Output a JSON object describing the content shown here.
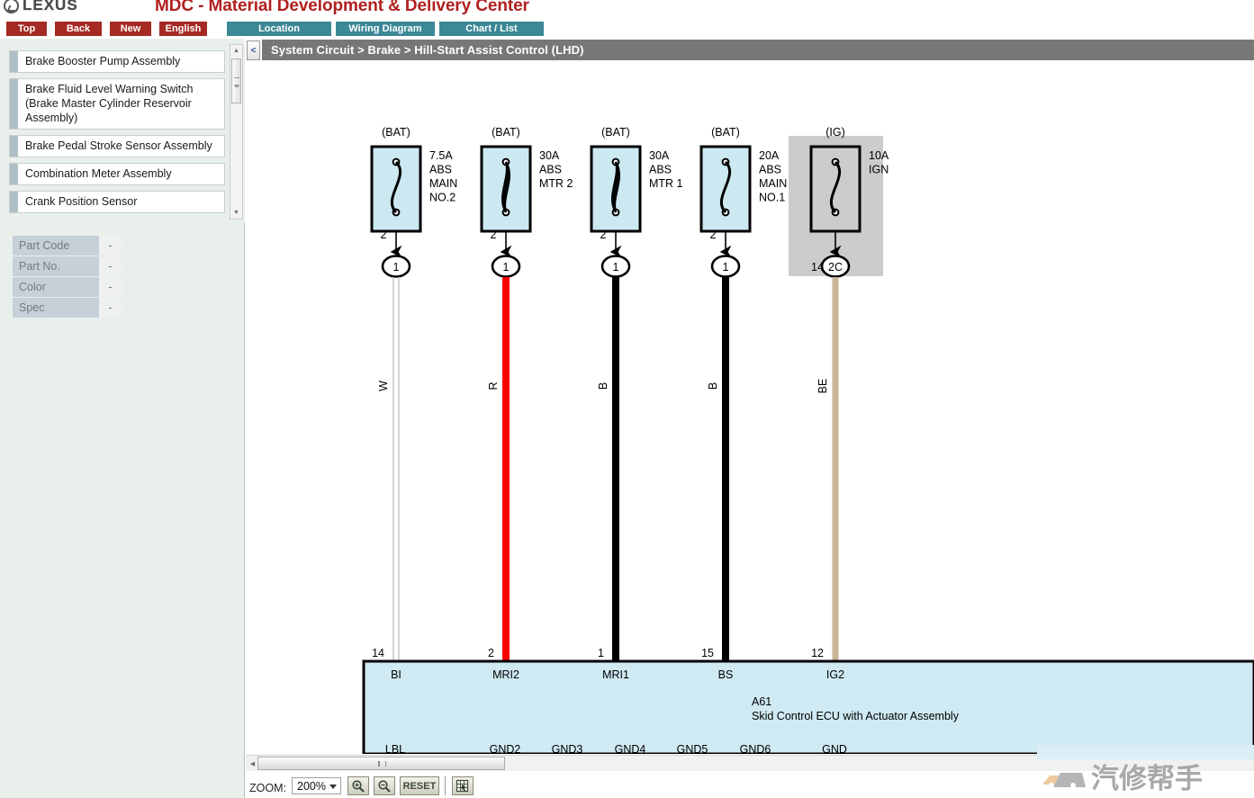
{
  "header": {
    "brand": "LEXUS",
    "brand_icon": "lexus-logo-icon",
    "title": "MDC - Material Development & Delivery Center"
  },
  "toolbar": {
    "nav_buttons": [
      {
        "label": "Top",
        "name": "top"
      },
      {
        "label": "Back",
        "name": "back"
      },
      {
        "label": "New",
        "name": "new"
      },
      {
        "label": "English",
        "name": "english"
      }
    ],
    "tabs": [
      {
        "label": "Location",
        "name": "location"
      },
      {
        "label": "Wiring Diagram",
        "name": "wiring-diagram"
      },
      {
        "label": "Chart / List",
        "name": "chart-list"
      }
    ],
    "red_color": "#a42a23",
    "teal_color": "#3c8896"
  },
  "sidebar": {
    "parts": [
      {
        "label": "Brake Booster Pump Assembly"
      },
      {
        "label": "Brake Fluid Level Warning Switch (Brake Master Cylinder Reservoir Assembly)"
      },
      {
        "label": "Brake Pedal Stroke Sensor Assembly"
      },
      {
        "label": "Combination Meter Assembly"
      },
      {
        "label": "Crank Position Sensor"
      }
    ],
    "part_info": [
      {
        "key": "Part Code",
        "value": "-"
      },
      {
        "key": "Part No.",
        "value": "-"
      },
      {
        "key": "Color",
        "value": "-"
      },
      {
        "key": "Spec",
        "value": "-"
      }
    ],
    "scroll_up_icon": "▲",
    "scroll_down_icon": "▼"
  },
  "breadcrumb": {
    "collapse_icon": "<",
    "path": "System Circuit > Brake > Hill-Start Assist Control (LHD)"
  },
  "zoombar": {
    "label": "ZOOM:",
    "level": "200%",
    "zoom_in_icon": "zoom-in-icon",
    "zoom_out_icon": "zoom-out-icon",
    "reset_label": "RESET",
    "grid_icon": "grid-select-icon",
    "scroll_left_icon": "◀"
  },
  "watermark": {
    "text": "汽修帮手",
    "icon": "car-logo-icon"
  },
  "diagram": {
    "ecu": {
      "code": "A61",
      "name": "Skid Control ECU with Actuator Assembly",
      "fill": "#cfeaf2",
      "top_pins": [
        "BI",
        "MRI2",
        "MRI1",
        "BS",
        "IG2"
      ],
      "bottom_pins": [
        "LBL",
        "GND2",
        "GND3",
        "GND4",
        "GND5",
        "GND6",
        "GND"
      ]
    },
    "fuses": [
      {
        "source": "(BAT)",
        "rating": "7.5A",
        "name_lines": [
          "ABS",
          "MAIN",
          "NO.2"
        ],
        "out_pin": "2",
        "connector": "1",
        "connector_prefix": "",
        "wire_color_code": "W",
        "wire_color": "#ffffff",
        "ecu_pin": "14",
        "ecu_pin_label": "BI",
        "shaded": false,
        "element": "s-curve"
      },
      {
        "source": "(BAT)",
        "rating": "30A",
        "name_lines": [
          "ABS",
          "MTR 2"
        ],
        "out_pin": "2",
        "connector": "1",
        "connector_prefix": "",
        "wire_color_code": "R",
        "wire_color": "#fb0000",
        "ecu_pin": "2",
        "ecu_pin_label": "MRI2",
        "shaded": false,
        "element": "coil"
      },
      {
        "source": "(BAT)",
        "rating": "30A",
        "name_lines": [
          "ABS",
          "MTR 1"
        ],
        "out_pin": "2",
        "connector": "1",
        "connector_prefix": "",
        "wire_color_code": "B",
        "wire_color": "#000000",
        "ecu_pin": "1",
        "ecu_pin_label": "MRI1",
        "shaded": false,
        "element": "coil"
      },
      {
        "source": "(BAT)",
        "rating": "20A",
        "name_lines": [
          "ABS",
          "MAIN",
          "NO.1"
        ],
        "out_pin": "2",
        "connector": "1",
        "connector_prefix": "",
        "wire_color_code": "B",
        "wire_color": "#000000",
        "ecu_pin": "15",
        "ecu_pin_label": "BS",
        "shaded": false,
        "element": "s-curve"
      },
      {
        "source": "(IG)",
        "rating": "10A",
        "name_lines": [
          "IGN"
        ],
        "out_pin": "",
        "connector": "2C",
        "connector_prefix": "14",
        "wire_color_code": "BE",
        "wire_color": "#c9b595",
        "ecu_pin": "12",
        "ecu_pin_label": "IG2",
        "shaded": true,
        "element": "s-curve"
      }
    ],
    "fuse_fill": "#cce9f2",
    "shade_fill": "#cccccc"
  }
}
